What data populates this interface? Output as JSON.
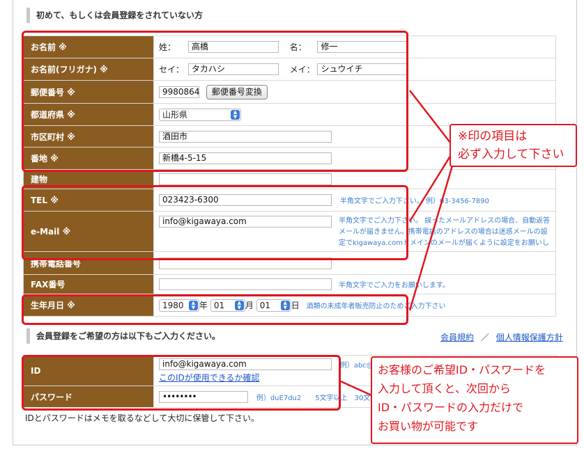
{
  "section1": {
    "title": "初めて、もしくは会員登録をされていない方"
  },
  "rows": {
    "name": {
      "label": "お名前 ※",
      "sei_label": "姓：",
      "sei_value": "高橋",
      "mei_label": "名：",
      "mei_value": "修一"
    },
    "kana": {
      "label": "お名前(フリガナ) ※",
      "sei_label": "セイ：",
      "sei_value": "タカハシ",
      "mei_label": "メイ：",
      "mei_value": "シュウイチ"
    },
    "zip": {
      "label": "郵便番号 ※",
      "value": "9980864",
      "button": "郵便番号変換"
    },
    "pref": {
      "label": "都道府県 ※",
      "value": "山形県"
    },
    "city": {
      "label": "市区町村 ※",
      "value": "酒田市"
    },
    "addr": {
      "label": "番地 ※",
      "value": "新橋4-5-15"
    },
    "building": {
      "label": "建物",
      "value": ""
    },
    "tel": {
      "label": "TEL ※",
      "value": "023423-6300",
      "note": "半角文字でご入力下さい。 例）03-3456-7890"
    },
    "email": {
      "label": "e-Mail ※",
      "value": "info@kigawaya.com",
      "note": "半角文字でご入力下さい。 誤ったメールアドレスの場合、自動返答メールが届きません。携帯電話のアドレスの場合は迷惑メールの設定でkigawaya.comドメインのメールが届くように設定をお願いします。"
    },
    "mobile": {
      "label": "携帯電話番号",
      "value": ""
    },
    "fax": {
      "label": "FAX番号",
      "value": "",
      "note": "半角文字でご入力をお願いします。"
    },
    "birth": {
      "label": "生年月日 ※",
      "year": "1980",
      "year_unit": "年",
      "month": "01",
      "month_unit": "月",
      "day": "01",
      "day_unit": "日",
      "note": "酒類の未成年者販売防止のためご入力下さい"
    }
  },
  "section2": {
    "title": "会員登録をご希望の方は以下もご入力ください。",
    "link_terms": "会員規約",
    "separator": "／",
    "link_privacy": "個人情報保護方針"
  },
  "account": {
    "id": {
      "label": "ID",
      "value": "info@kigawaya.com",
      "check_link": "このIDが使用できるか確認",
      "note": "例）abc@"
    },
    "password": {
      "label": "パスワード",
      "value": "••••••••",
      "note": "例）duE7du2　　5文字以上　30文"
    },
    "memo": "IDとパスワードはメモを取るなどして大切に保管して下さい。"
  },
  "callouts": {
    "required": [
      "※印の項目は",
      "必ず入力して下さい"
    ],
    "account": [
      "お客様のご希望ID・パスワードを",
      "入力して頂くと、次回から",
      "ID・パスワードの入力だけで",
      "お買い物が可能です"
    ]
  },
  "colors": {
    "header_bg": "#8a5c22",
    "highlight": "#e0171f",
    "link": "#1a55c8",
    "note": "#3a7fd0"
  }
}
